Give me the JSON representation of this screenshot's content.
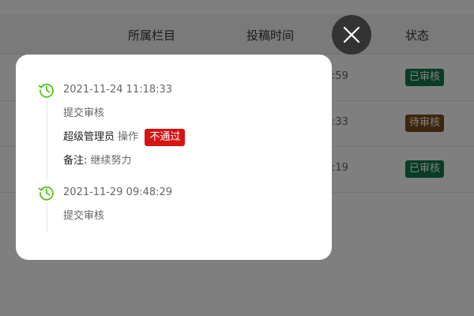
{
  "table": {
    "headers": [
      "所属栏目",
      "投稿时间",
      "状态"
    ],
    "rows": [
      {
        "time_fragment": ":59",
        "status": "已审核",
        "status_color": "#0f7a4c"
      },
      {
        "time_fragment": ":33",
        "status": "待审核",
        "status_color": "#7a4a1c"
      },
      {
        "time_fragment": ":19",
        "status": "已审核",
        "status_color": "#0f7a4c"
      }
    ]
  },
  "dialog": {
    "timeline": [
      {
        "time": "2021-11-24 11:18:33",
        "action": "提交审核",
        "operator": "超级管理员",
        "operation_label": "操作",
        "result": "不通过",
        "note_label": "备注:",
        "note_text": "继续努力"
      },
      {
        "time": "2021-11-29 09:48:29",
        "action": "提交审核"
      }
    ]
  },
  "colors": {
    "timeline_icon": "#52c41a",
    "reject_badge": "#d71414"
  },
  "icons": {
    "close": "close-icon",
    "timeline": "history-clock-icon"
  }
}
